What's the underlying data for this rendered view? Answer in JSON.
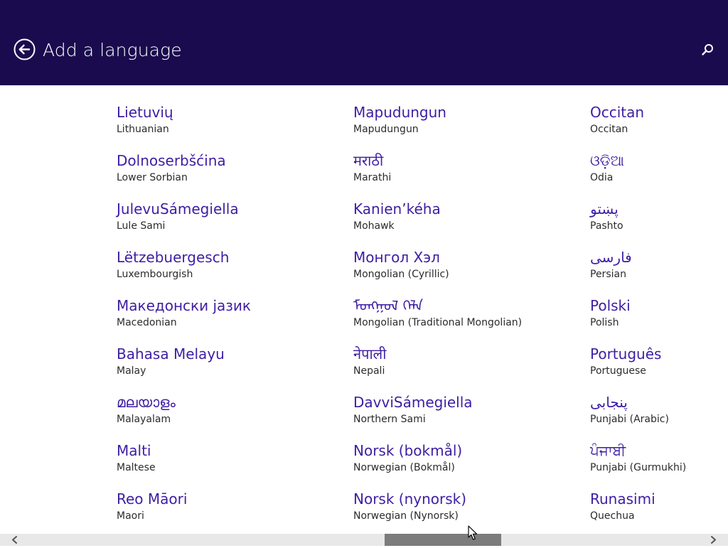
{
  "header": {
    "title": "Add a language",
    "back_icon": "back-arrow-icon",
    "search_icon": "search-icon",
    "background_color": "#1a0b4e"
  },
  "languages": [
    [
      {
        "native": "Lietuvių",
        "english": "Lithuanian"
      },
      {
        "native": "Dolnoserbšćina",
        "english": "Lower Sorbian"
      },
      {
        "native": "JulevuSámegiella",
        "english": "Lule Sami"
      },
      {
        "native": "Lëtzebuergesch",
        "english": "Luxembourgish"
      },
      {
        "native": "Македонски јазик",
        "english": "Macedonian"
      },
      {
        "native": "Bahasa Melayu",
        "english": "Malay"
      },
      {
        "native": "മലയാളം",
        "english": "Malayalam"
      },
      {
        "native": "Malti",
        "english": "Maltese"
      },
      {
        "native": "Reo Māori",
        "english": "Maori"
      }
    ],
    [
      {
        "native": "Mapudungun",
        "english": "Mapudungun"
      },
      {
        "native": "मराठी",
        "english": "Marathi"
      },
      {
        "native": "Kanien’kéha",
        "english": "Mohawk"
      },
      {
        "native": "Монгол Хэл",
        "english": "Mongolian (Cyrillic)"
      },
      {
        "native": "ᠮᠣᠩᠭᠣᠯ ᠬᠡᠯᠡ",
        "english": "Mongolian (Traditional Mongolian)"
      },
      {
        "native": "नेपाली",
        "english": "Nepali"
      },
      {
        "native": "DavviSámegiella",
        "english": "Northern Sami"
      },
      {
        "native": "Norsk (bokmål)",
        "english": "Norwegian (Bokmål)"
      },
      {
        "native": "Norsk (nynorsk)",
        "english": "Norwegian (Nynorsk)"
      }
    ],
    [
      {
        "native": "Occitan",
        "english": "Occitan"
      },
      {
        "native": "ଓଡ଼ିଆ",
        "english": "Odia"
      },
      {
        "native": "پښتو",
        "english": "Pashto"
      },
      {
        "native": "فارسی",
        "english": "Persian"
      },
      {
        "native": "Polski",
        "english": "Polish"
      },
      {
        "native": "Português",
        "english": "Portuguese"
      },
      {
        "native": "پنجابی",
        "english": "Punjabi (Arabic)"
      },
      {
        "native": "ਪੰਜਾਬੀ",
        "english": "Punjabi (Gurmukhi)"
      },
      {
        "native": "Runasimi",
        "english": "Quechua"
      }
    ]
  ],
  "scrollbar": {
    "left_icon": "chevron-left-icon",
    "right_icon": "chevron-right-icon"
  },
  "colors": {
    "accent": "#3e1ea3",
    "secondary_text": "#2b2b2b",
    "scrollbar_track": "#e8e8e8",
    "scrollbar_thumb": "#7c7c7c"
  }
}
